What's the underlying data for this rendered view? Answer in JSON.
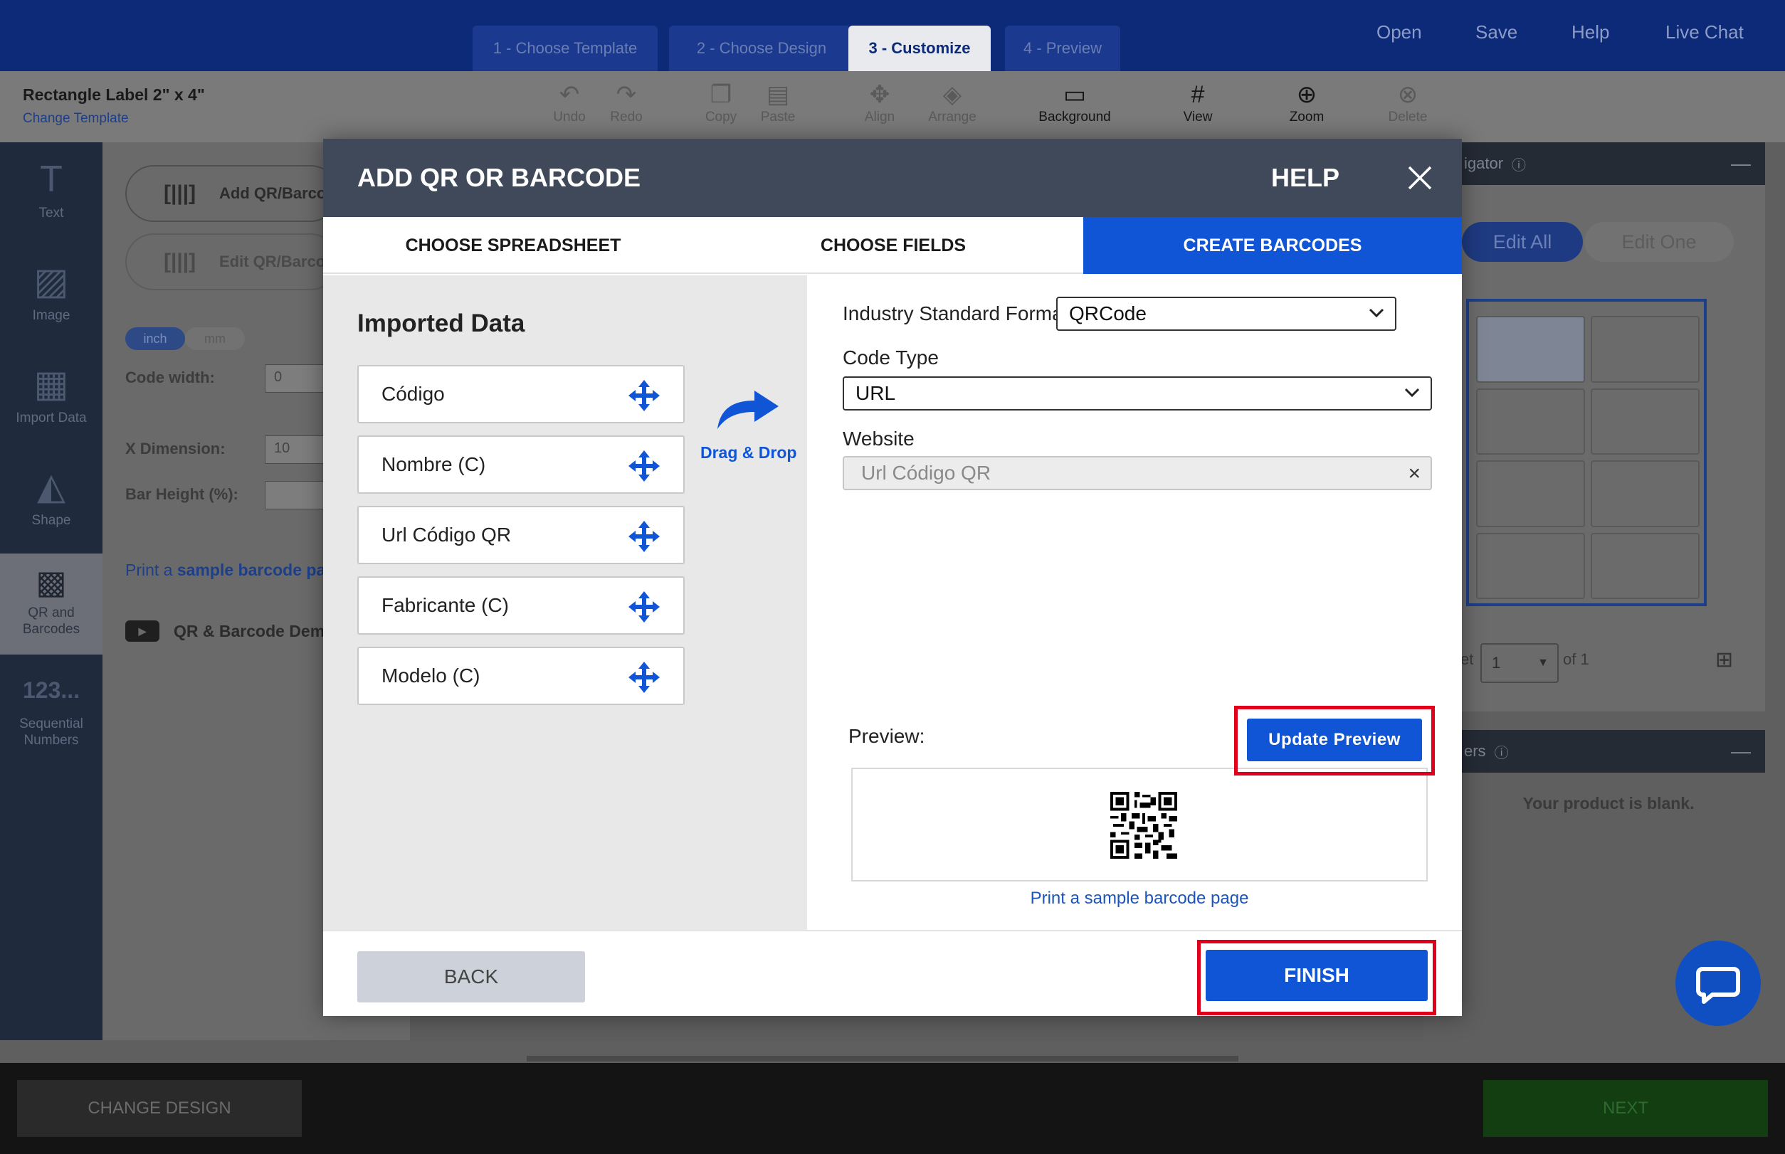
{
  "app": {
    "steps": [
      "1 - Choose Template",
      "2 - Choose Design",
      "3 - Customize",
      "4 - Preview"
    ],
    "top_nav": [
      "Open",
      "Save",
      "Help",
      "Live Chat"
    ],
    "product_title": "Rectangle Label 2\" x 4\"",
    "change_template": "Change Template",
    "tools": {
      "undo": "Undo",
      "redo": "Redo",
      "copy": "Copy",
      "paste": "Paste",
      "align": "Align",
      "arrange": "Arrange",
      "background": "Background",
      "view": "View",
      "zoom": "Zoom",
      "delete": "Delete"
    },
    "left_tools": {
      "text": "Text",
      "image": "Image",
      "import_data": "Import Data",
      "shape": "Shape",
      "qr": "QR and Barcodes",
      "sequential": "Sequential Numbers",
      "seq_glyph": "123..."
    },
    "left_panel": {
      "add_qr": "Add QR/Barco",
      "edit_qr": "Edit QR/Barco",
      "unit_inch": "inch",
      "unit_mm": "mm",
      "code_width_label": "Code width:",
      "code_width_value": "0",
      "x_dimension_label": "X Dimension:",
      "x_dimension_value": "10",
      "bar_height_label": "Bar Height (%):",
      "print_prefix": "Print a ",
      "print_link": "sample barcode pa",
      "demo": "QR & Barcode Demo"
    },
    "right_panel": {
      "navigator": "igator",
      "edit_all": "Edit All",
      "edit_one": "Edit One",
      "sheet_prefix": "et",
      "sheet_value": "1",
      "sheet_of": "of 1",
      "layers": "ers",
      "blank": "Your product is blank."
    },
    "footer": {
      "change_design": "CHANGE DESIGN",
      "next": "NEXT"
    }
  },
  "modal": {
    "title": "ADD QR OR BARCODE",
    "help": "HELP",
    "tabs": [
      "CHOOSE SPREADSHEET",
      "CHOOSE FIELDS",
      "CREATE BARCODES"
    ],
    "active_tab": 2,
    "imported_heading": "Imported Data",
    "fields": [
      "Código",
      "Nombre (C)",
      "Url Código QR",
      "Fabricante (C)",
      "Modelo (C)"
    ],
    "drag_drop": "Drag & Drop",
    "format_label": "Industry Standard Format",
    "format_value": "QRCode",
    "code_type_label": "Code Type",
    "code_type_value": "URL",
    "website_label": "Website",
    "website_value": "Url Código QR",
    "preview_label": "Preview:",
    "update_preview": "Update Preview",
    "sample_link": "Print a sample barcode page",
    "back": "BACK",
    "finish": "FINISH"
  },
  "colors": {
    "primary": "#0f55d6",
    "header": "#404959",
    "highlight": "#e0001b",
    "topbar": "#0d2a78"
  }
}
